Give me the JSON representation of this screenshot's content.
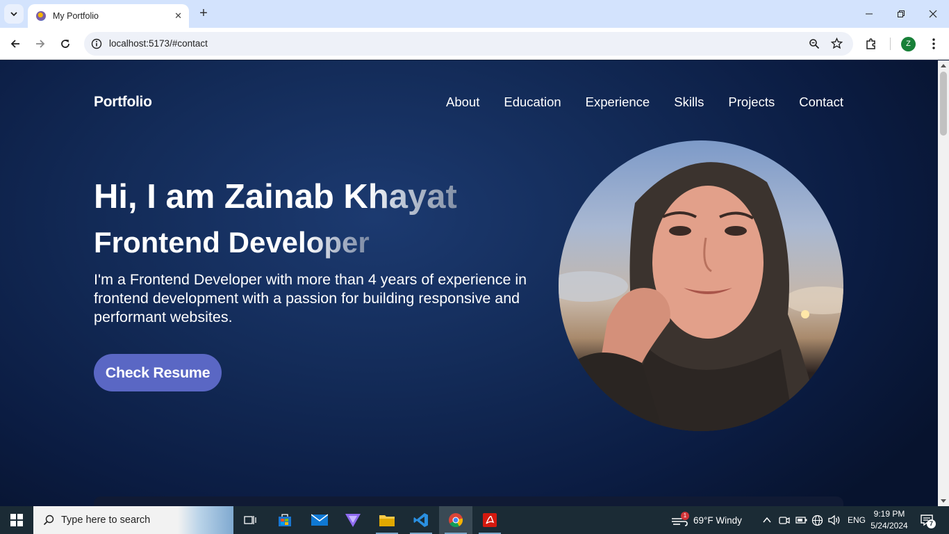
{
  "browser": {
    "tab_title": "My Portfolio",
    "tab_close": "✕",
    "new_tab": "+",
    "url": "localhost:5173/#contact",
    "profile_initial": "Z"
  },
  "site": {
    "logo": "Portfolio",
    "nav": [
      "About",
      "Education",
      "Experience",
      "Skills",
      "Projects",
      "Contact"
    ],
    "greeting_main": "Hi, I am Zainab K",
    "greeting_fade": "hayat",
    "role_main": "Frontend Devel",
    "role_fade": "oper",
    "description": "I'm a Frontend Developer with more than 4 years of experience in frontend development with a passion for building responsive and performant websites.",
    "resume_button": "Check Resume"
  },
  "taskbar": {
    "search_placeholder": "Type here to search",
    "weather": "69°F  Windy",
    "weather_badge": "1",
    "language": "ENG",
    "time": "9:19 PM",
    "date": "5/24/2024",
    "notification_count": "7"
  }
}
